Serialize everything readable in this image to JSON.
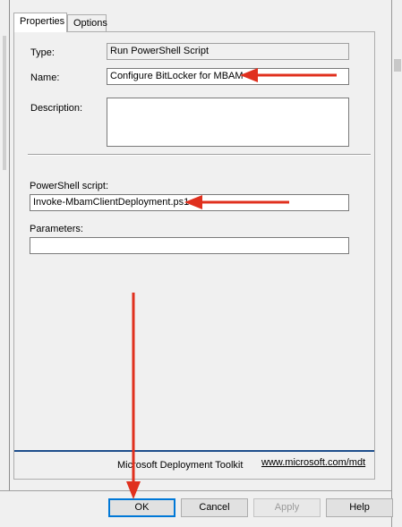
{
  "tabs": [
    {
      "label": "Properties",
      "active": true
    },
    {
      "label": "Options",
      "active": false
    }
  ],
  "form": {
    "type_label": "Type:",
    "type_value": "Run PowerShell Script",
    "name_label": "Name:",
    "name_value": "Configure BitLocker for MBAM",
    "description_label": "Description:",
    "description_value": "",
    "script_label": "PowerShell script:",
    "script_value": "Invoke-MbamClientDeployment.ps1",
    "parameters_label": "Parameters:",
    "parameters_value": ""
  },
  "footer": {
    "product": "Microsoft Deployment Toolkit",
    "link": "www.microsoft.com/mdt"
  },
  "buttons": {
    "ok": "OK",
    "cancel": "Cancel",
    "apply": "Apply",
    "help": "Help"
  },
  "colors": {
    "annotation_arrow": "#e0301e",
    "footer_line": "#1e4e8c",
    "default_button_border": "#0078d7"
  }
}
